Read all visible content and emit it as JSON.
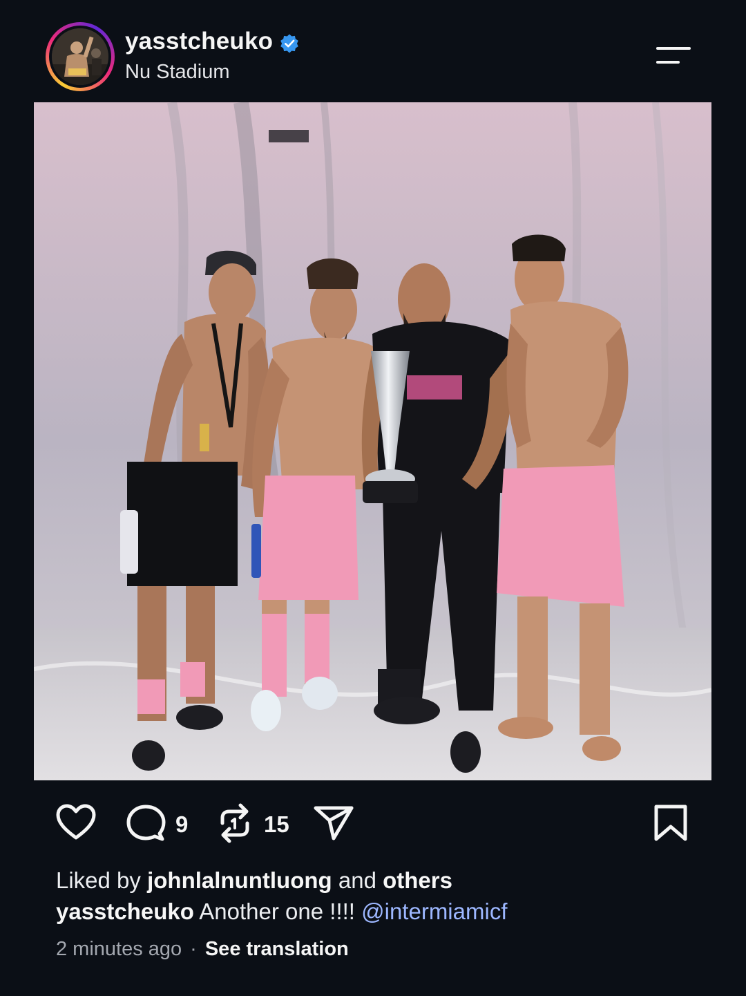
{
  "post": {
    "username": "yasstcheuko",
    "location": "Nu Stadium",
    "verified": true
  },
  "actions": {
    "comments_count": "9",
    "reposts_count": "15"
  },
  "likes": {
    "prefix": "Liked by",
    "user": "johnlalnuntluong",
    "middle": "and",
    "suffix": "others"
  },
  "caption": {
    "username": "yasstcheuko",
    "text": "Another one !!!!",
    "mention": "@intermiamicf"
  },
  "meta": {
    "time": "2 minutes ago",
    "separator": "·",
    "translate": "See translation"
  },
  "colors": {
    "background": "#0b0f16",
    "verified_badge": "#3797f0",
    "mention": "#9db7ff",
    "kit_pink": "#f19ab7"
  }
}
